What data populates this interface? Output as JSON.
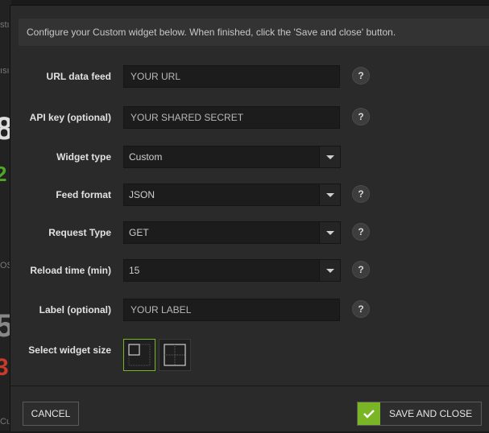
{
  "background": {
    "fragments": [
      "stı",
      "ısı",
      "8",
      "2",
      "OS",
      "5",
      "3",
      "Cu"
    ],
    "colors": {
      "green": "#4da82a",
      "red": "#c83a2a"
    }
  },
  "info": "Configure your Custom widget below. When finished, click the 'Save and close' button.",
  "form": {
    "url": {
      "label": "URL data feed",
      "placeholder": "YOUR URL"
    },
    "api": {
      "label": "API key (optional)",
      "placeholder": "YOUR SHARED SECRET"
    },
    "widget_type": {
      "label": "Widget type",
      "value": "Custom"
    },
    "feed_format": {
      "label": "Feed format",
      "value": "JSON"
    },
    "request_type": {
      "label": "Request Type",
      "value": "GET"
    },
    "reload_time": {
      "label": "Reload time (min)",
      "value": "15"
    },
    "label_field": {
      "label": "Label (optional)",
      "placeholder": "YOUR LABEL"
    },
    "size": {
      "label": "Select widget size",
      "selected_index": 0
    }
  },
  "help_glyph": "?",
  "icons": {
    "help": "help-icon",
    "dropdown": "chevron-down-icon",
    "check": "check-icon"
  },
  "buttons": {
    "cancel": "CANCEL",
    "save": "SAVE AND CLOSE"
  },
  "accent": "#7ab526"
}
